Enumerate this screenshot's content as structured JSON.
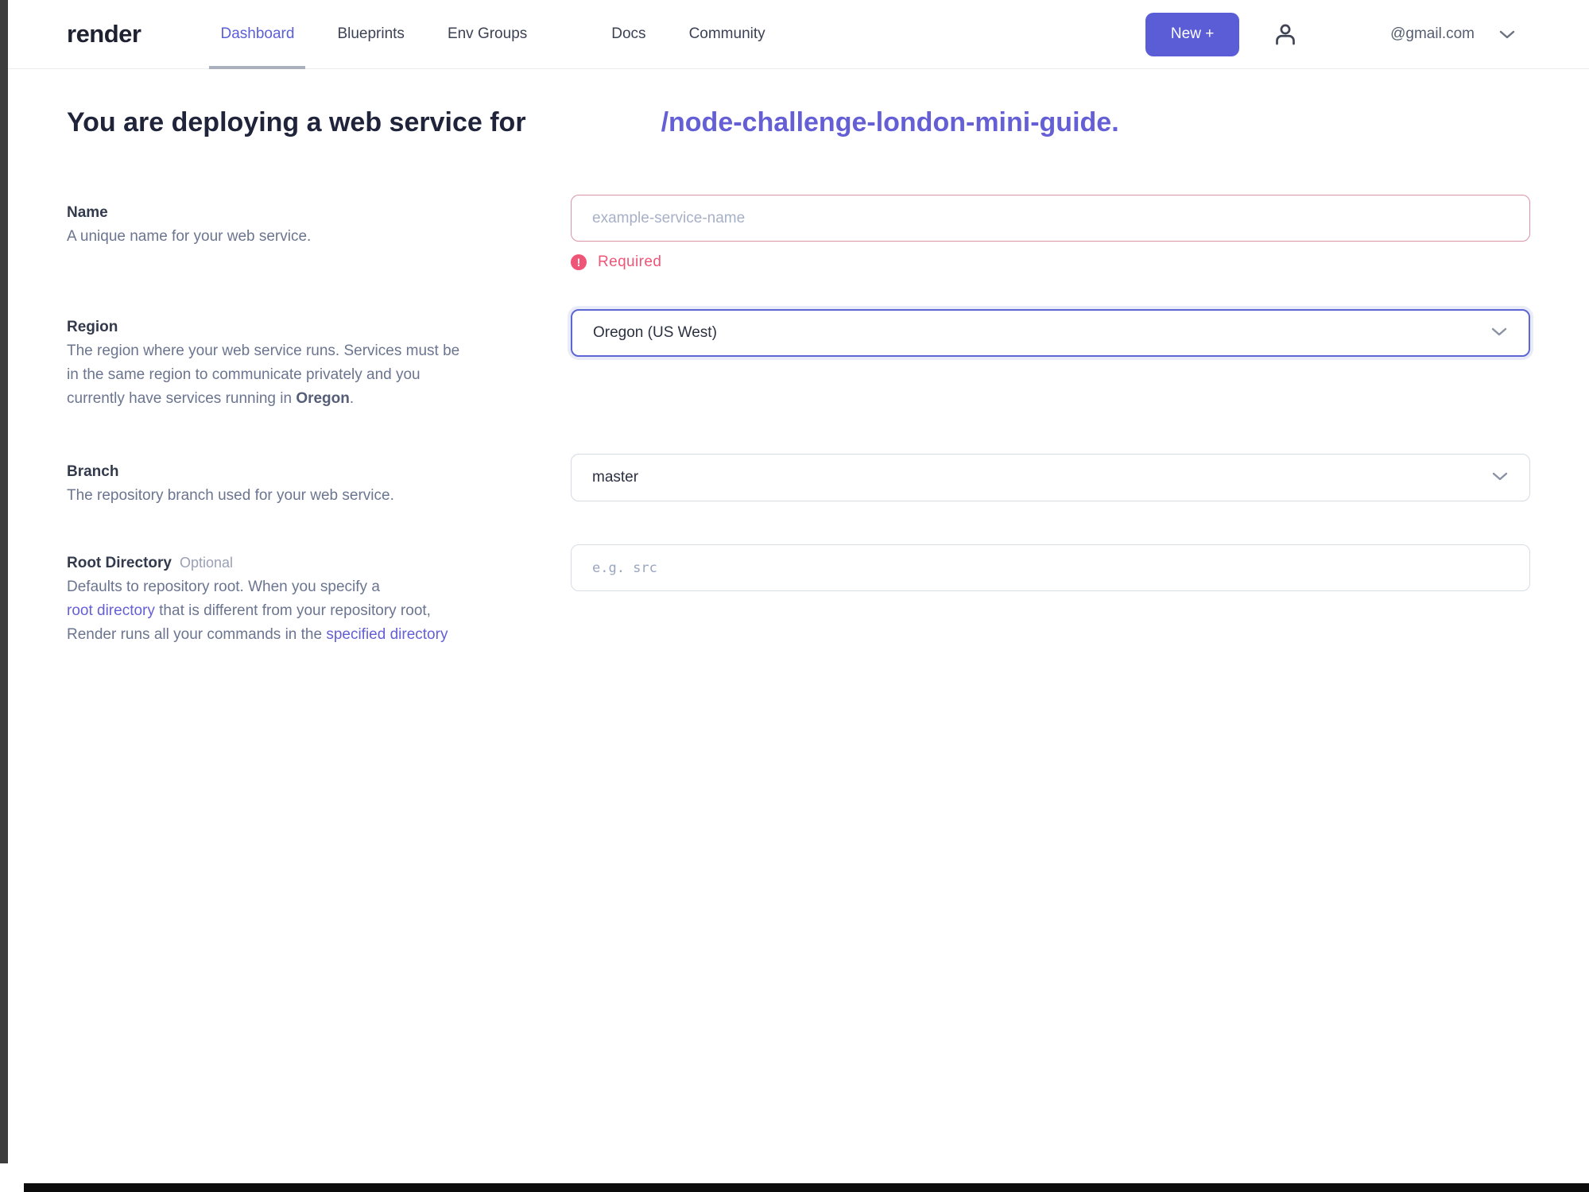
{
  "brand": {
    "accent_color": "#5a5dd6",
    "link_color": "#655fd6",
    "error_color": "#ee5577"
  },
  "nav": {
    "logo_text": "render",
    "items": [
      {
        "id": "dashboard",
        "label": "Dashboard",
        "active": true
      },
      {
        "id": "blueprints",
        "label": "Blueprints",
        "active": false
      },
      {
        "id": "env-groups",
        "label": "Env Groups",
        "active": false
      },
      {
        "id": "docs",
        "label": "Docs",
        "active": false
      },
      {
        "id": "community",
        "label": "Community",
        "active": false
      }
    ],
    "new_button_label": "New +",
    "account": {
      "email": "@gmail.com"
    }
  },
  "heading": {
    "prefix": "You are deploying a web service for",
    "repo_link": "/node-challenge-london-mini-guide",
    "suffix": "."
  },
  "form": {
    "name": {
      "label": "Name",
      "description": "A unique name for your web service.",
      "placeholder": "example-service-name",
      "value": "",
      "error_message": "Required"
    },
    "region": {
      "label": "Region",
      "desc_line1": "The region where your web service runs. Services must be",
      "desc_line2": "in the same region to communicate privately and you",
      "desc_line3_before": "currently have services running in ",
      "desc_line3_bold": "Oregon",
      "desc_line3_suffix": ".",
      "selected_value": "Oregon (US West)"
    },
    "branch": {
      "label": "Branch",
      "description": "The repository branch used for your web service.",
      "selected_value": "master"
    },
    "root_directory": {
      "label": "Root Directory",
      "optional_tag": "Optional",
      "desc_line1": "Defaults to repository root. When you specify a",
      "link1": "root directory",
      "desc_line2_after": " that is different from your repository root,",
      "desc_line3_before": "Render runs all your commands in the ",
      "link2": "specified directory",
      "placeholder": "e.g. src",
      "value": ""
    }
  }
}
